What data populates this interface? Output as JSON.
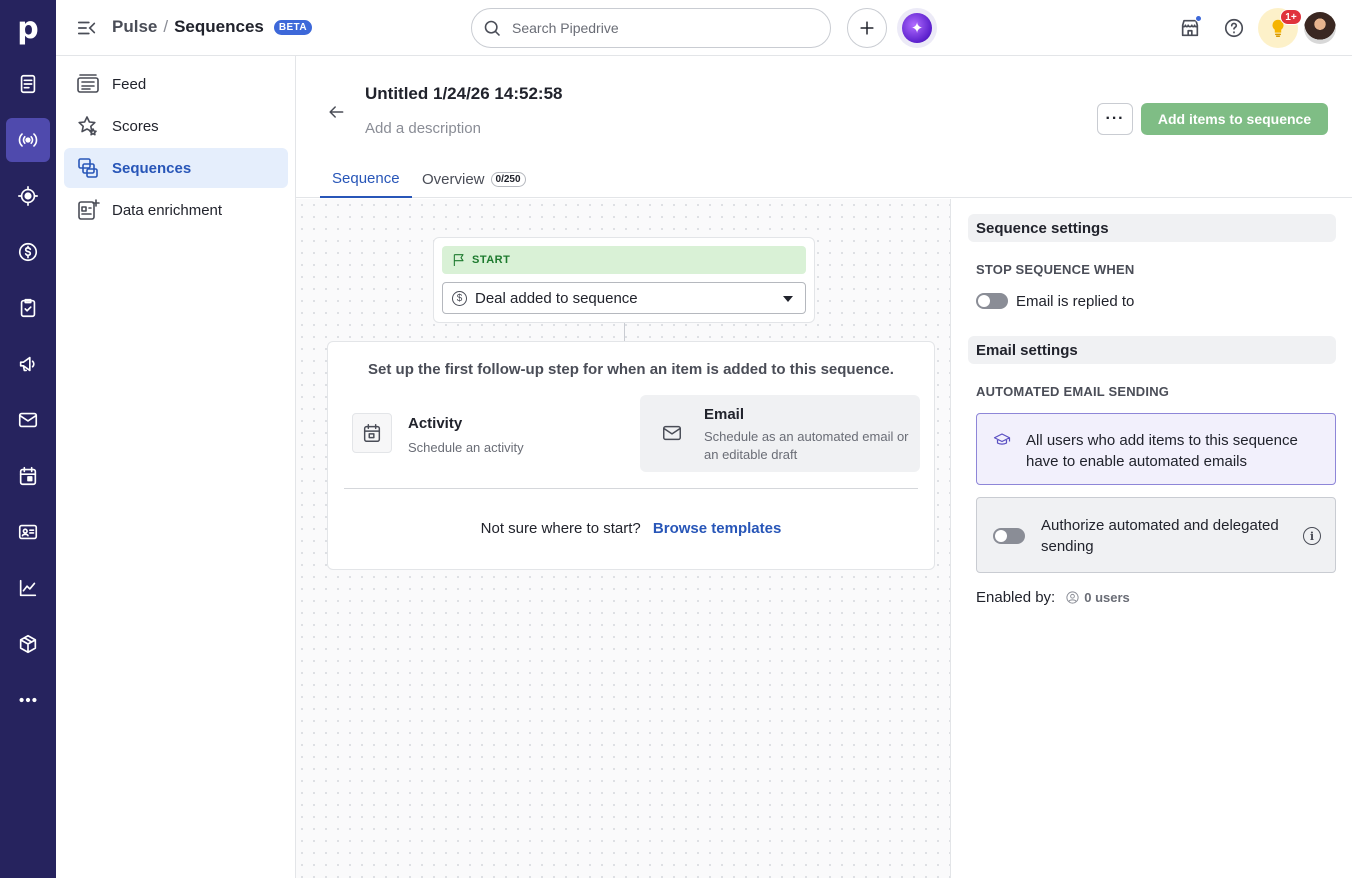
{
  "app": {
    "logo": "p",
    "breadcrumb": {
      "parent": "Pulse",
      "separator": "/",
      "current": "Sequences",
      "badge": "BETA"
    },
    "search": {
      "placeholder": "Search Pipedrive"
    },
    "notifications_badge": "1+"
  },
  "rail": {
    "items": [
      {
        "name": "leads-icon",
        "active": false
      },
      {
        "name": "pulse-icon",
        "active": true
      },
      {
        "name": "target-icon",
        "active": false
      },
      {
        "name": "deals-icon",
        "active": false
      },
      {
        "name": "tasks-icon",
        "active": false
      },
      {
        "name": "campaigns-icon",
        "active": false
      },
      {
        "name": "mail-icon",
        "active": false
      },
      {
        "name": "calendar-icon",
        "active": false
      },
      {
        "name": "contacts-icon",
        "active": false
      },
      {
        "name": "insights-icon",
        "active": false
      },
      {
        "name": "products-icon",
        "active": false
      },
      {
        "name": "more-icon",
        "active": false
      }
    ]
  },
  "sidenav": {
    "items": [
      {
        "label": "Feed",
        "icon": "feed-icon",
        "active": false
      },
      {
        "label": "Scores",
        "icon": "scores-icon",
        "active": false
      },
      {
        "label": "Sequences",
        "icon": "sequences-icon",
        "active": true
      },
      {
        "label": "Data enrichment",
        "icon": "data-enrichment-icon",
        "active": false
      }
    ]
  },
  "header": {
    "title": "Untitled 1/24/26 14:52:58",
    "description_placeholder": "Add a description",
    "more_label": "···",
    "primary_button": "Add items to sequence"
  },
  "tabs": [
    {
      "label": "Sequence",
      "active": true
    },
    {
      "label": "Overview",
      "count": "0/250",
      "active": false
    }
  ],
  "canvas": {
    "start_label": "START",
    "trigger": {
      "icon": "dollar-icon",
      "value": "Deal added to sequence"
    },
    "step_prompt": "Set up the first follow-up step for when an item is added to this sequence.",
    "options": [
      {
        "title": "Activity",
        "subtitle": "Schedule an activity",
        "icon": "calendar-icon"
      },
      {
        "title": "Email",
        "subtitle": "Schedule as an automated email or an editable draft",
        "icon": "envelope-icon"
      }
    ],
    "browse_prompt": "Not sure where to start?",
    "browse_link": "Browse templates"
  },
  "settings": {
    "sequence_header": "Sequence settings",
    "stop_label": "STOP SEQUENCE WHEN",
    "stop_toggle_label": "Email is replied to",
    "email_header": "Email settings",
    "auto_label": "AUTOMATED EMAIL SENDING",
    "info_text": "All users who add items to this sequence have to enable automated emails",
    "authorize_label": "Authorize automated and delegated sending",
    "enabled_by_label": "Enabled by:",
    "enabled_users": "0 users"
  },
  "colors": {
    "rail_bg": "#26235e",
    "rail_active": "#4f4aad",
    "accent_blue": "#2856b8",
    "primary_green_disabled": "#7fbd85",
    "start_bg": "#d9f1d6",
    "info_bg": "#f2f0fc"
  }
}
